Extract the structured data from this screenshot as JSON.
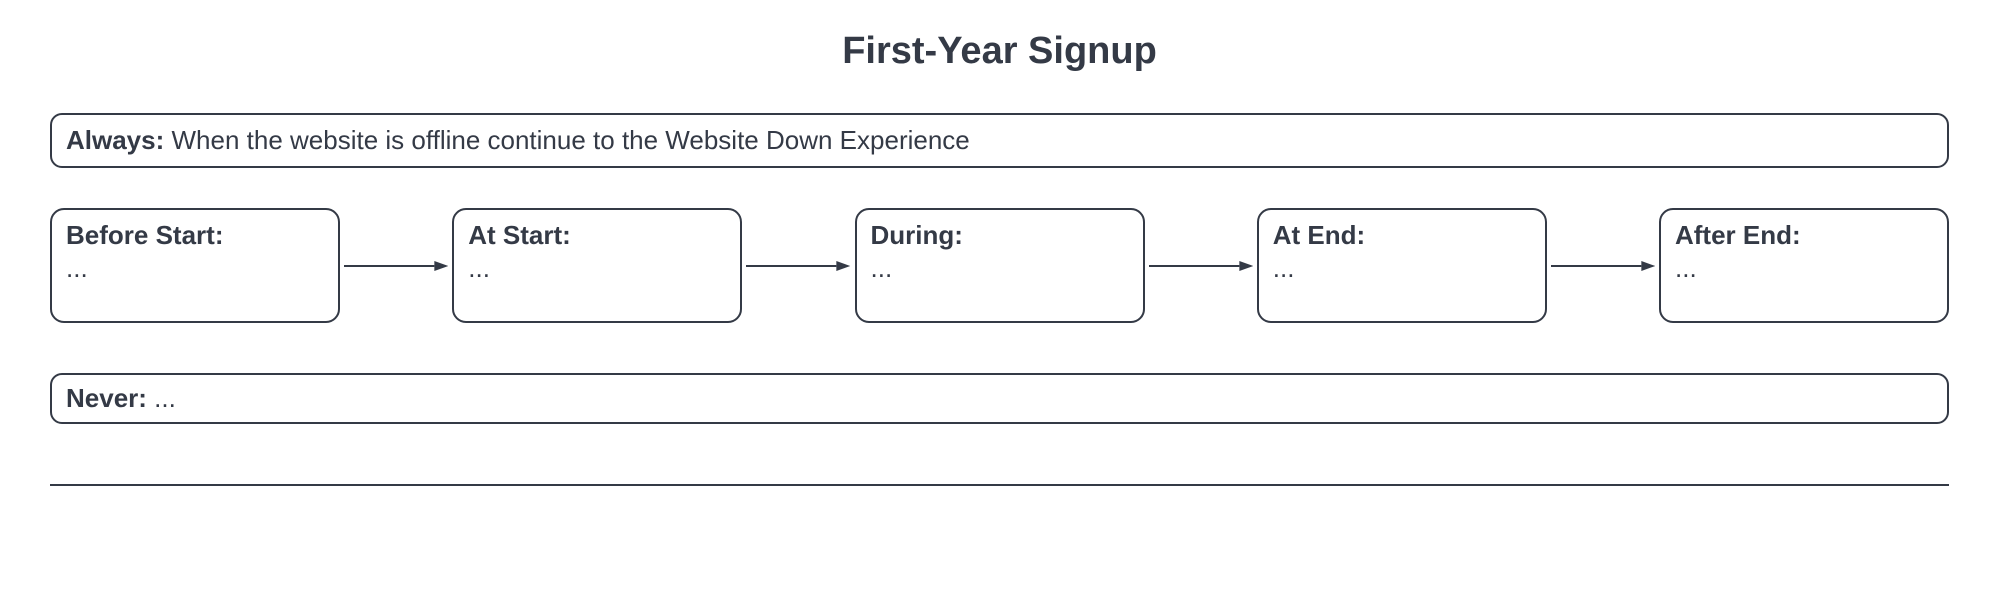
{
  "title": "First-Year Signup",
  "always": {
    "label": "Always:",
    "text": " When the website is offline continue to the Website Down Experience"
  },
  "stages": [
    {
      "label": "Before Start:",
      "content": "..."
    },
    {
      "label": "At Start:",
      "content": "..."
    },
    {
      "label": "During:",
      "content": "..."
    },
    {
      "label": "At End:",
      "content": "..."
    },
    {
      "label": "After End:",
      "content": "..."
    }
  ],
  "never": {
    "label": "Never:",
    "text": " ..."
  }
}
